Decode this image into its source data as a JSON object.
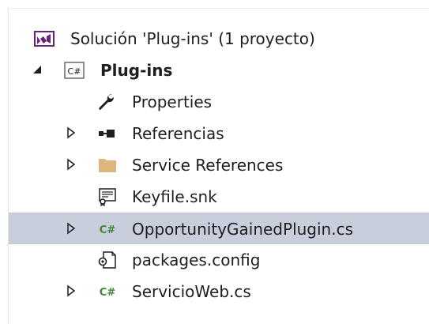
{
  "solution_explorer": {
    "solution": {
      "label": "Solución 'Plug-ins'  (1 proyecto)",
      "icon": "visual-studio-solution-icon"
    },
    "project": {
      "label": "Plug-ins",
      "icon": "csharp-project-icon",
      "expanded": true
    },
    "items": [
      {
        "label": "Properties",
        "icon": "wrench-icon",
        "expandable": false
      },
      {
        "label": "Referencias",
        "icon": "references-icon",
        "expandable": true
      },
      {
        "label": "Service References",
        "icon": "folder-icon",
        "expandable": true
      },
      {
        "label": "Keyfile.snk",
        "icon": "key-certificate-icon",
        "expandable": false
      },
      {
        "label": "OpportunityGainedPlugin.cs",
        "icon": "csharp-file-icon",
        "expandable": true,
        "selected": true
      },
      {
        "label": "packages.config",
        "icon": "config-file-icon",
        "expandable": false
      },
      {
        "label": "ServicioWeb.cs",
        "icon": "csharp-file-icon",
        "expandable": true
      }
    ]
  },
  "colors": {
    "selection": "#c9cedd",
    "folder": "#dcb67a",
    "csharp": "#388a34",
    "vs_purple": "#68217a",
    "text": "#1e1e1e"
  }
}
